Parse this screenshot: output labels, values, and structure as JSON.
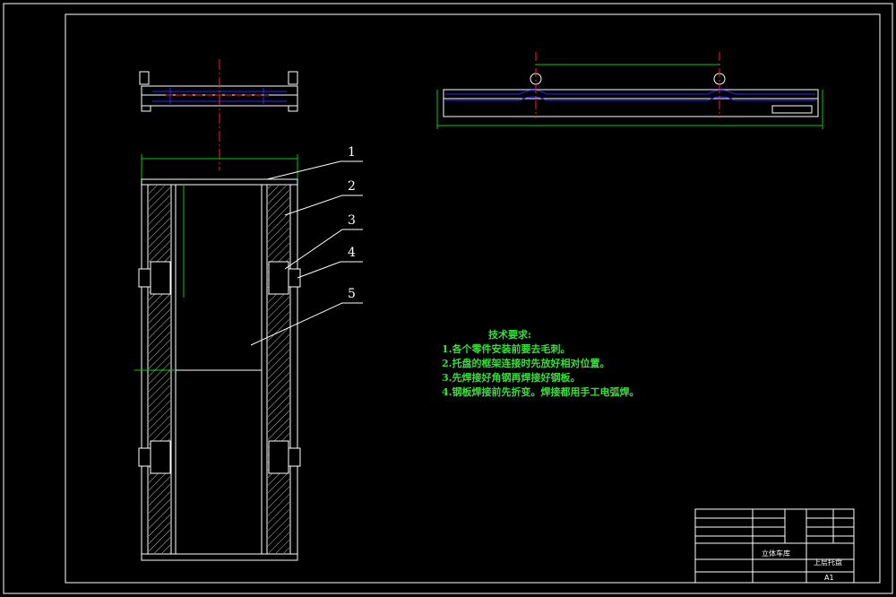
{
  "callouts": [
    "1",
    "2",
    "3",
    "4",
    "5"
  ],
  "notes": {
    "title": "技术要求:",
    "items": [
      "1.各个零件安装前要去毛刺。",
      "2.托盘的框架连接时先放好相对位置。",
      "3.先焊接好角钢再焊接好钢板。",
      "4.钢板焊接前先折变。焊接都用手工电弧焊。"
    ]
  },
  "title_block": {
    "part_name": "上层托盘",
    "project": "立体车库",
    "drawing_no": "A1"
  },
  "colors": {
    "background": "#000000",
    "lines": "#ffffff",
    "notes": "#36e03a",
    "hidden": "#2a2aff",
    "centerline": "#ff2020",
    "dimension": "#00d000"
  }
}
